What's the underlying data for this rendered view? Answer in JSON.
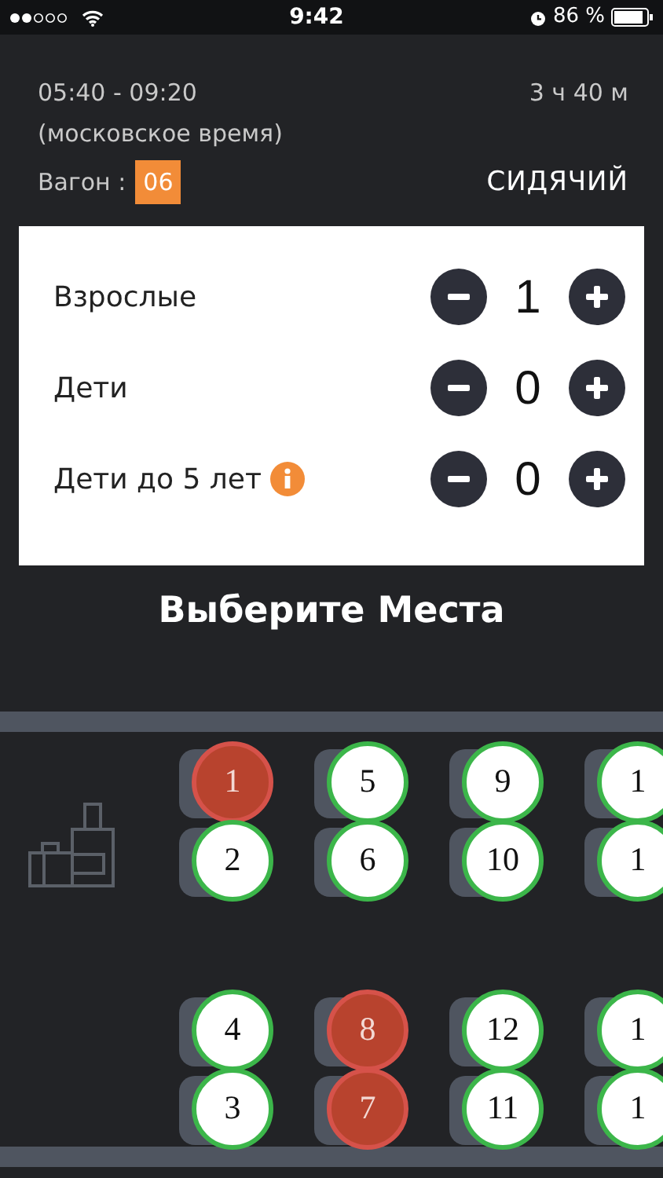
{
  "status_bar": {
    "time": "9:42",
    "battery": "86 %"
  },
  "trip": {
    "times": "05:40 - 09:20",
    "duration": "3 ч 40 м",
    "timezone": "(московское время)",
    "car_label": "Вагон :",
    "car_number": "06",
    "car_type": "СИДЯЧИЙ"
  },
  "passengers": [
    {
      "label": "Взрослые",
      "count": "1",
      "info": false
    },
    {
      "label": "Дети",
      "count": "0",
      "info": false
    },
    {
      "label": "Дети до 5 лет",
      "count": "0",
      "info": true
    }
  ],
  "title": "Выберите Места",
  "seat_columns": [
    {
      "seats": [
        {
          "label": "1",
          "taken": true
        },
        {
          "label": "2",
          "taken": false
        },
        {
          "label": "4",
          "taken": false
        },
        {
          "label": "3",
          "taken": false
        }
      ]
    },
    {
      "seats": [
        {
          "label": "5",
          "taken": false
        },
        {
          "label": "6",
          "taken": false
        },
        {
          "label": "8",
          "taken": true
        },
        {
          "label": "7",
          "taken": true
        }
      ]
    },
    {
      "seats": [
        {
          "label": "9",
          "taken": false
        },
        {
          "label": "10",
          "taken": false
        },
        {
          "label": "12",
          "taken": false
        },
        {
          "label": "11",
          "taken": false
        }
      ]
    },
    {
      "seats": [
        {
          "label": "1",
          "taken": false
        },
        {
          "label": "1",
          "taken": false
        },
        {
          "label": "1",
          "taken": false
        },
        {
          "label": "1",
          "taken": false
        }
      ]
    }
  ]
}
